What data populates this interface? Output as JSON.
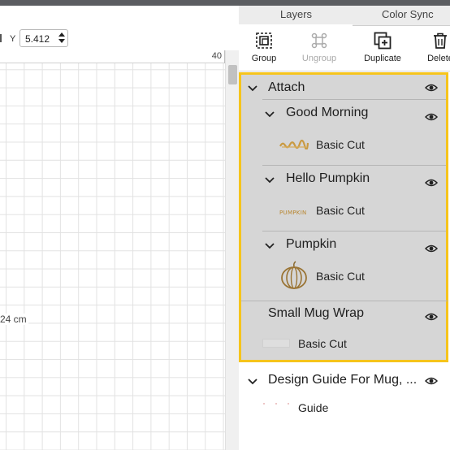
{
  "position": {
    "y_label": "Y",
    "y_value": "5.412"
  },
  "canvas": {
    "ruler_number": "40",
    "dimension_label": "24 cm"
  },
  "panel": {
    "tabs": [
      {
        "label": "Layers",
        "active": true
      },
      {
        "label": "Color Sync",
        "active": false
      }
    ],
    "actions": [
      {
        "label": "Group",
        "icon": "group-icon",
        "enabled": true
      },
      {
        "label": "Ungroup",
        "icon": "ungroup-icon",
        "enabled": false
      },
      {
        "label": "Duplicate",
        "icon": "duplicate-icon",
        "enabled": true
      },
      {
        "label": "Delete",
        "icon": "trash-icon",
        "enabled": true
      }
    ],
    "highlight_color": "#f6c41c",
    "layers": {
      "attach": {
        "title": "Attach",
        "children": [
          {
            "title": "Good Morning",
            "item": "Basic Cut",
            "thumb": "good-morning-thumbnail"
          },
          {
            "title": "Hello Pumpkin",
            "item": "Basic Cut",
            "thumb": "pumpkin-text-thumbnail",
            "thumb_text": "PUMPKIN"
          },
          {
            "title": "Pumpkin",
            "item": "Basic Cut",
            "thumb": "pumpkin-thumbnail"
          }
        ]
      },
      "small_mug_wrap": {
        "title": "Small Mug Wrap",
        "item": "Basic Cut"
      },
      "design_guide": {
        "title": "Design Guide For Mug, ...",
        "item": "Guide"
      }
    }
  }
}
